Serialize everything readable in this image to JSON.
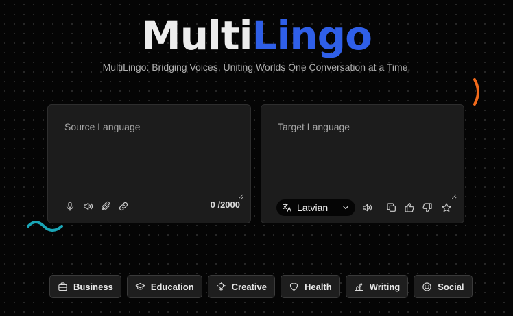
{
  "brand": {
    "part1": "Multi",
    "part2": "Lingo"
  },
  "tagline": "MultiLingo: Bridging Voices, Uniting Worlds One Conversation at a Time.",
  "source": {
    "placeholder": "Source Language",
    "value": "",
    "counter": "0 /2000",
    "icons": [
      "microphone-icon",
      "speaker-icon",
      "paperclip-icon",
      "link-icon"
    ]
  },
  "target": {
    "placeholder": "Target Language",
    "value": "",
    "language": "Latvian",
    "icons": [
      "translate-icon",
      "speaker-icon",
      "copy-icon",
      "thumbs-up-icon",
      "thumbs-down-icon",
      "star-icon"
    ]
  },
  "categories": [
    {
      "label": "Business",
      "icon": "briefcase-icon"
    },
    {
      "label": "Education",
      "icon": "graduation-cap-icon"
    },
    {
      "label": "Creative",
      "icon": "lightbulb-icon"
    },
    {
      "label": "Health",
      "icon": "heart-icon"
    },
    {
      "label": "Writing",
      "icon": "writing-icon"
    },
    {
      "label": "Social",
      "icon": "smile-icon"
    }
  ],
  "colors": {
    "accent": "#2f5fe8",
    "decoration_orange": "#f26a1b",
    "decoration_teal": "#1aa6b7"
  }
}
